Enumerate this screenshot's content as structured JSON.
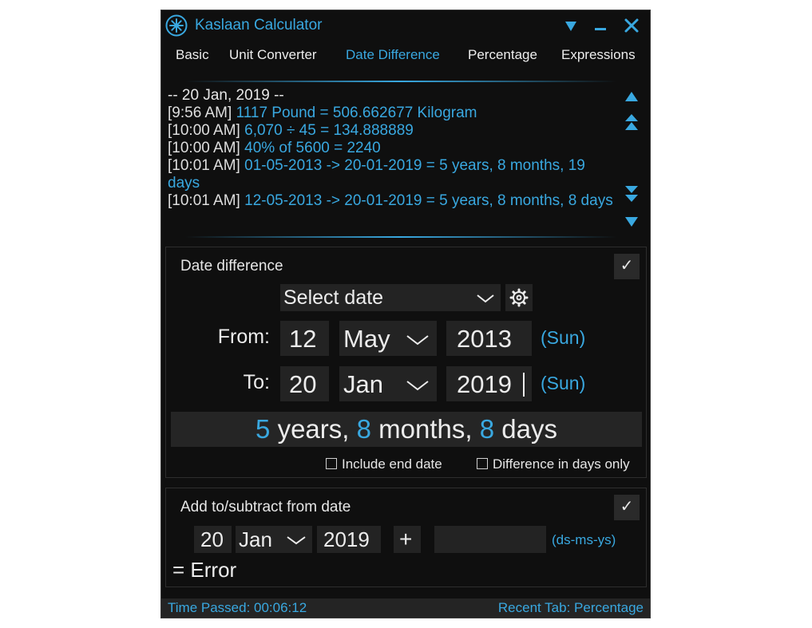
{
  "window": {
    "title": "Kaslaan Calculator"
  },
  "icons": {
    "logo": "asterisk-logo-icon",
    "menu": "triangle-down-icon",
    "minimize": "minimize-icon",
    "close": "close-icon",
    "scroll_up": "triangle-up-icon",
    "scroll_top": "double-chevron-up-icon",
    "scroll_bottom": "double-chevron-down-icon",
    "scroll_down": "triangle-down-icon",
    "dropdown": "chevron-down-icon",
    "settings": "gear-icon",
    "check": "checkmark-icon",
    "checkbox": "checkbox-icon"
  },
  "colors": {
    "accent": "#39a8e0",
    "background": "#0f0f0f",
    "field": "#232323"
  },
  "tabs": [
    {
      "label": "Basic",
      "active": false
    },
    {
      "label": "Unit Converter",
      "active": false
    },
    {
      "label": "Date Difference",
      "active": true
    },
    {
      "label": "Percentage",
      "active": false
    },
    {
      "label": "Expressions",
      "active": false
    }
  ],
  "history": {
    "date_header": "-- 20 Jan, 2019 --",
    "entries": [
      {
        "time": "[9:56 AM]",
        "text": "1117 Pound = 506.662677 Kilogram"
      },
      {
        "time": "[10:00 AM]",
        "text": "6,070 ÷ 45 = 134.888889"
      },
      {
        "time": "[10:00 AM]",
        "text": "40% of 5600 = 2240"
      },
      {
        "time": "[10:01 AM]",
        "text": "01-05-2013 -> 20-01-2019 = 5 years, 8 months, 19 days"
      },
      {
        "time": "[10:01 AM]",
        "text": "12-05-2013 -> 20-01-2019 = 5 years, 8 months, 8 days"
      }
    ]
  },
  "date_difference": {
    "title": "Date difference",
    "select_date": "Select date",
    "from": {
      "label": "From:",
      "day": "12",
      "month": "May",
      "year": "2013",
      "weekday": "(Sun)"
    },
    "to": {
      "label": "To:",
      "day": "20",
      "month": "Jan",
      "year": "2019",
      "weekday": "(Sun)"
    },
    "result": {
      "years": "5",
      "years_label": "years,",
      "months": "8",
      "months_label": "months,",
      "days": "8",
      "days_label": "days"
    },
    "include_end_date": {
      "label": "Include end date",
      "checked": false
    },
    "days_only": {
      "label": "Difference in days only",
      "checked": false
    }
  },
  "add_subtract": {
    "title": "Add to/subtract from date",
    "day": "20",
    "month": "Jan",
    "year": "2019",
    "operator": "+",
    "amount": "",
    "format_hint": "(ds-ms-ys)",
    "result": "= Error"
  },
  "status": {
    "time_passed": "Time Passed: 00:06:12",
    "recent_tab": "Recent Tab: Percentage"
  }
}
